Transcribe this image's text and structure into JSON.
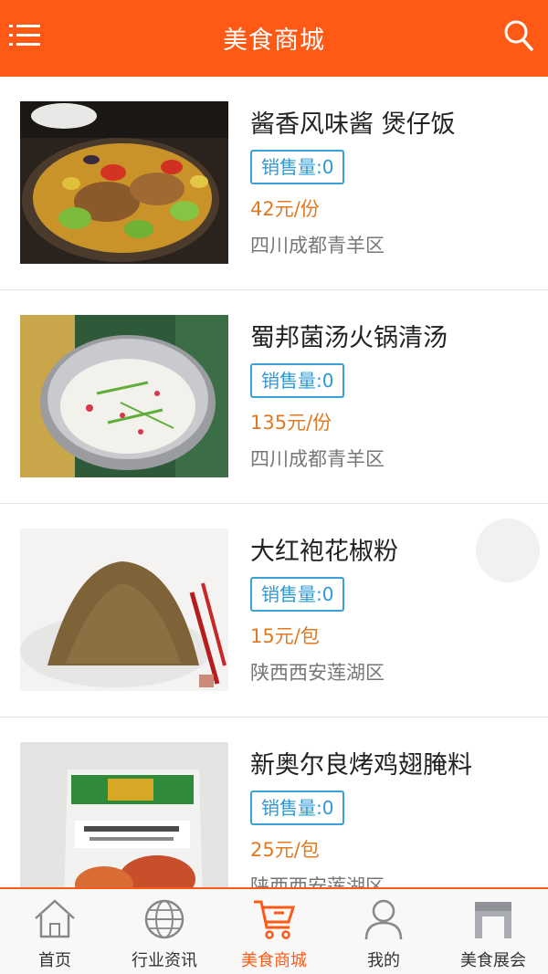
{
  "header": {
    "title": "美食商城",
    "menu_icon": "menu-icon",
    "search_icon": "search-icon",
    "bg_color": "#fe5a16"
  },
  "products": [
    {
      "name": "酱香风味酱 煲仔饭",
      "sales": "销售量:0",
      "price": "42元/份",
      "region": "四川成都青羊区",
      "image": "stir-fry-dish-photo"
    },
    {
      "name": "蜀邦菌汤火锅清汤",
      "sales": "销售量:0",
      "price": "135元/份",
      "region": "四川成都青羊区",
      "image": "hot-pot-soup-photo"
    },
    {
      "name": "大红袍花椒粉",
      "sales": "销售量:0",
      "price": "15元/包",
      "region": "陕西西安莲湖区",
      "image": "pepper-powder-photo"
    },
    {
      "name": "新奥尔良烤鸡翅腌料",
      "sales": "销售量:0",
      "price": "25元/包",
      "region": "陕西西安莲湖区",
      "image": "marinade-package-photo"
    }
  ],
  "tabbar": {
    "active_color": "#fe5a16",
    "items": [
      {
        "label": "首页",
        "icon": "home-icon"
      },
      {
        "label": "行业资讯",
        "icon": "globe-icon"
      },
      {
        "label": "美食商城",
        "icon": "cart-icon",
        "active": true
      },
      {
        "label": "我的",
        "icon": "user-icon"
      },
      {
        "label": "美食展会",
        "icon": "store-icon"
      }
    ]
  }
}
